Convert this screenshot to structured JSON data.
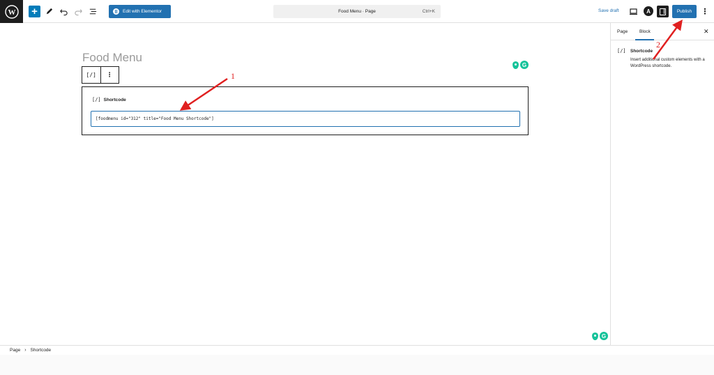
{
  "header": {
    "edit_elementor_label": "Edit with Elementor",
    "command_title": "Food Menu · Page",
    "command_shortcut": "Ctrl+K",
    "save_draft_label": "Save draft",
    "publish_label": "Publish",
    "a_label": "A"
  },
  "editor": {
    "page_title": "Food Menu",
    "transform_icon_text": "[/]",
    "options_text": "⋮",
    "block": {
      "icon_text": "[/]",
      "label": "Shortcode",
      "value": "[foodmenu id=\"312\" title=\"Food Menu Shortcode\"]"
    }
  },
  "sidebar": {
    "tabs": [
      {
        "label": "Page"
      },
      {
        "label": "Block"
      }
    ],
    "active_tab": "Block",
    "close_label": "✕",
    "block_icon_text": "[/]",
    "block_title": "Shortcode",
    "block_description": "Insert additional custom elements with a WordPress shortcode."
  },
  "annotations": {
    "marker_1": "1",
    "marker_2": "2"
  },
  "breadcrumb": {
    "items": [
      "Page",
      "Shortcode"
    ],
    "separator": "›"
  },
  "colors": {
    "accent": "#2271b1",
    "annotation": "#e02020",
    "grammarly": "#15c39a"
  }
}
